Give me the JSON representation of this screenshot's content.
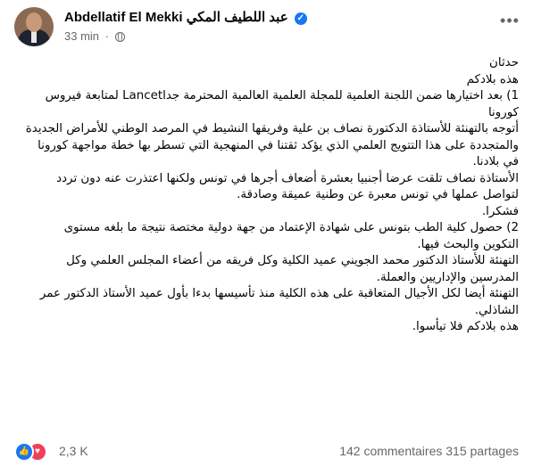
{
  "post": {
    "author_latin": "Abdellatif El Mekki",
    "author_arabic": "عبد اللطيف المكي",
    "time": "33 min",
    "separator": "·"
  },
  "body_lines": [
    "حدثان",
    "هذه بلادكم",
    "1) بعد اختيارها ضمن اللجنة العلمية للمجلة العلمية العالمية المحترمة جداLancet لمتابعة فيروس",
    "كورونا",
    "أتوجه بالتهنئة للأستاذة الدكتورة نصاف بن علية وفريقها النشيط في المرصد الوطني للأمراض الجديدة",
    "والمتجددة على هذا التتويج العلمي الذي يؤكد ثقتنا في المنهجية التي تسطر بها خطة مواجهة كورونا",
    "في بلادنا.",
    "الأستاذة نصاف تلقت عرضا أجنبيا بعشرة أضعاف أجرها في تونس ولكنها اعتذرت عنه دون تردد",
    "لتواصل عملها في تونس معبرة عن وطنية عميقة وصادقة.",
    "فشكرا.",
    "2) حصول كلية الطب بتونس على شهادة الإعتماد من جهة دولية مختصة نتيجة ما بلغه مستوى",
    "التكوين والبحث فيها.",
    "التهنئة للأستاذ الدكتور محمد الجويني عميد الكلية وكل فريقه من أعضاء المجلس العلمي وكل",
    "المدرسين والإداريين والعملة.",
    "التهنئة أيضا لكل الأجيال المتعاقبة على هذه الكلية منذ تأسيسها بدءا بأول عميد الأستاذ الدكتور عمر",
    "الشاذلي.",
    "هذه بلادكم فلا تيأسوا."
  ],
  "reactions": {
    "count": "2,3 K",
    "like_icon": "thumbs-up-icon",
    "love_icon": "heart-icon"
  },
  "stats": {
    "comments": "142 commentaires",
    "shares": "315 partages"
  },
  "colors": {
    "like": "#1877f2",
    "love": "#f33e58",
    "muted_text": "#65676b"
  }
}
